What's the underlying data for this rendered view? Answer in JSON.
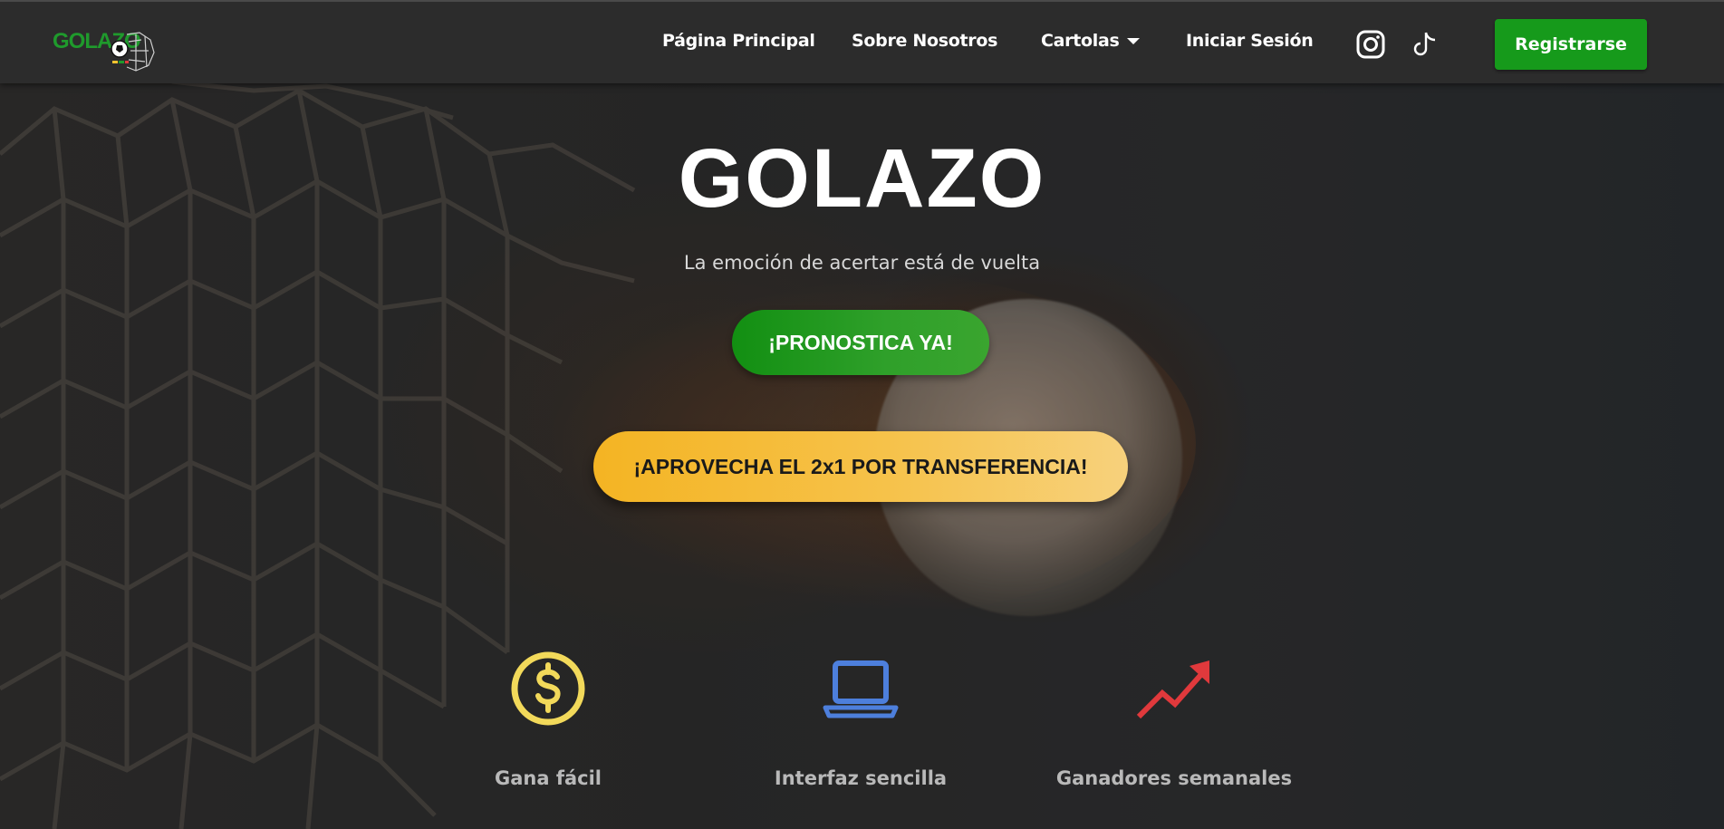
{
  "nav": {
    "logo_alt": "GOLAZO",
    "links": [
      {
        "label": "Página Principal"
      },
      {
        "label": "Sobre Nosotros"
      },
      {
        "label": "Cartolas"
      },
      {
        "label": "Iniciar Sesión"
      }
    ],
    "social": [
      {
        "icon": "instagram-icon"
      },
      {
        "icon": "tiktok-icon"
      }
    ],
    "register_label": "Registrarse"
  },
  "hero": {
    "title": "GOLAZO",
    "subtitle": "La emoción de acertar está de vuelta",
    "cta_label": "¡PRONOSTICA YA!",
    "promo_label": "¡APROVECHA EL 2x1 POR TRANSFERENCIA!"
  },
  "features": [
    {
      "icon": "dollar-coin-icon",
      "label": "Gana fácil",
      "color": "#f2d95a"
    },
    {
      "icon": "laptop-icon",
      "label": "Interfaz sencilla",
      "color": "#4d7fdc"
    },
    {
      "icon": "trending-up-icon",
      "label": "Ganadores semanales",
      "color": "#e0393c"
    }
  ],
  "colors": {
    "brand_green": "#169a1b",
    "promo_yellow": "#f4b423",
    "nav_bg": "#2c2c2c"
  }
}
